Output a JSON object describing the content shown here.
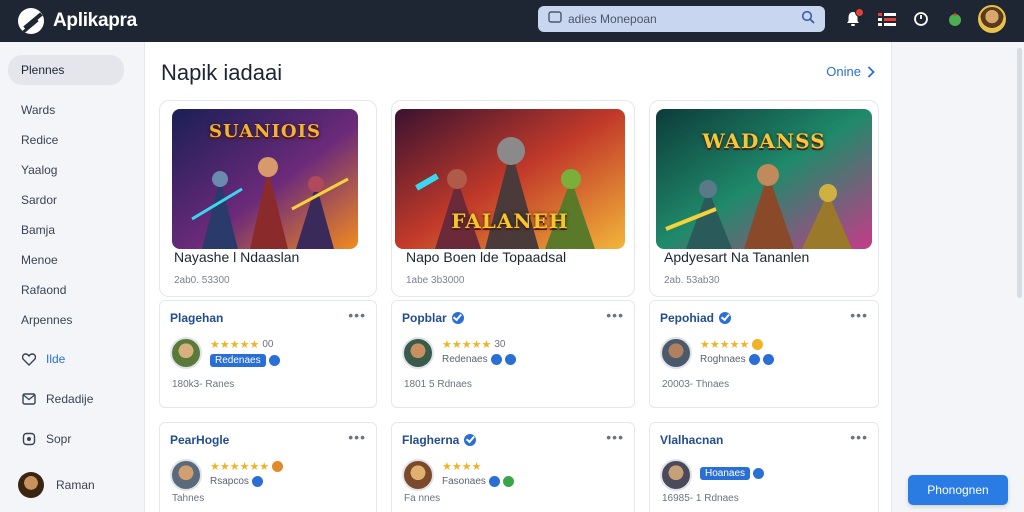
{
  "app": {
    "name": "Aplikapra"
  },
  "search": {
    "placeholder": "adies Monepoan"
  },
  "sidebar": {
    "items": [
      {
        "label": "Plennes",
        "active": true
      },
      {
        "label": "Wards"
      },
      {
        "label": "Redice"
      },
      {
        "label": "Yaalog"
      },
      {
        "label": "Sardor"
      },
      {
        "label": "Bamja"
      },
      {
        "label": "Menoe"
      },
      {
        "label": "Rafaond"
      },
      {
        "label": "Arpennes"
      },
      {
        "label": "Ilde",
        "icon": "heart-icon"
      },
      {
        "label": "Redadije",
        "icon": "mail-icon"
      },
      {
        "label": "Sopr",
        "icon": "shop-icon"
      }
    ],
    "user": {
      "name": "Raman"
    }
  },
  "main": {
    "title": "Napik iadaai",
    "online_label": "Onine",
    "games": [
      {
        "thumb_text": "SUANIOIS",
        "thumb_colors": [
          "#1a1f55",
          "#6b2a7a",
          "#f38a1f"
        ],
        "title_color": "#f2b233",
        "name": "Nayashe l Ndaaslan",
        "meta": "2ab0. 53300"
      },
      {
        "thumb_text": "FALANEH",
        "thumb_colors": [
          "#3a1230",
          "#c23a2a",
          "#f3b53a"
        ],
        "title_color": "#f5c62a",
        "name": "Napo Boen lde Topaadsal",
        "meta": "1abe 3b3000"
      },
      {
        "thumb_text": "WADANSS",
        "thumb_colors": [
          "#0d3b3a",
          "#1f8a6a",
          "#c63a8a"
        ],
        "title_color": "#f0c83a",
        "name": "Apdyesart Na Tananlen",
        "meta": "2ab. 53ab30"
      }
    ],
    "publishers": [
      {
        "name": "Plagehan",
        "verified": false,
        "stars": "★★★★★",
        "rating": "00",
        "badge": "Redenaes",
        "stat": "180k3- Ranes",
        "avatar": [
          "#5a7a3a",
          "#d8b080"
        ]
      },
      {
        "name": "Popblar",
        "verified": true,
        "stars": "★★★★★",
        "rating": "30",
        "badge": "Redenaes",
        "stat": "1801 5 Rdnaes",
        "avatar": [
          "#3a5a4a",
          "#c89060"
        ]
      },
      {
        "name": "Pepohiad",
        "verified": true,
        "stars": "★★★★★",
        "rating": "",
        "badge": "Roghnaes",
        "stat": "20003- Thnaes",
        "avatar": [
          "#4a5a6a",
          "#b08060"
        ]
      },
      {
        "name": "PearHogle",
        "verified": false,
        "stars": "★★★★★★",
        "rating": "",
        "badge": "Rsapcos",
        "stat": "Tahnes",
        "avatar": [
          "#5a6a7a",
          "#d0a070"
        ]
      },
      {
        "name": "Flagherna",
        "verified": true,
        "stars": "★★★★",
        "rating": "",
        "badge": "Fasonaes",
        "stat": "Fa nnes",
        "avatar": [
          "#7a4a2a",
          "#e0b070"
        ]
      },
      {
        "name": "Vlalhacnan",
        "verified": false,
        "stars": "",
        "rating": "",
        "badge": "Hoanaes",
        "stat": "16985- 1 Rdnaes",
        "avatar": [
          "#4a4a5a",
          "#c8a078"
        ]
      }
    ]
  },
  "cta": {
    "label": "Phonognen"
  },
  "colors": {
    "accent": "#2a7be4",
    "topbar": "#1f2633",
    "star": "#f0b323"
  }
}
